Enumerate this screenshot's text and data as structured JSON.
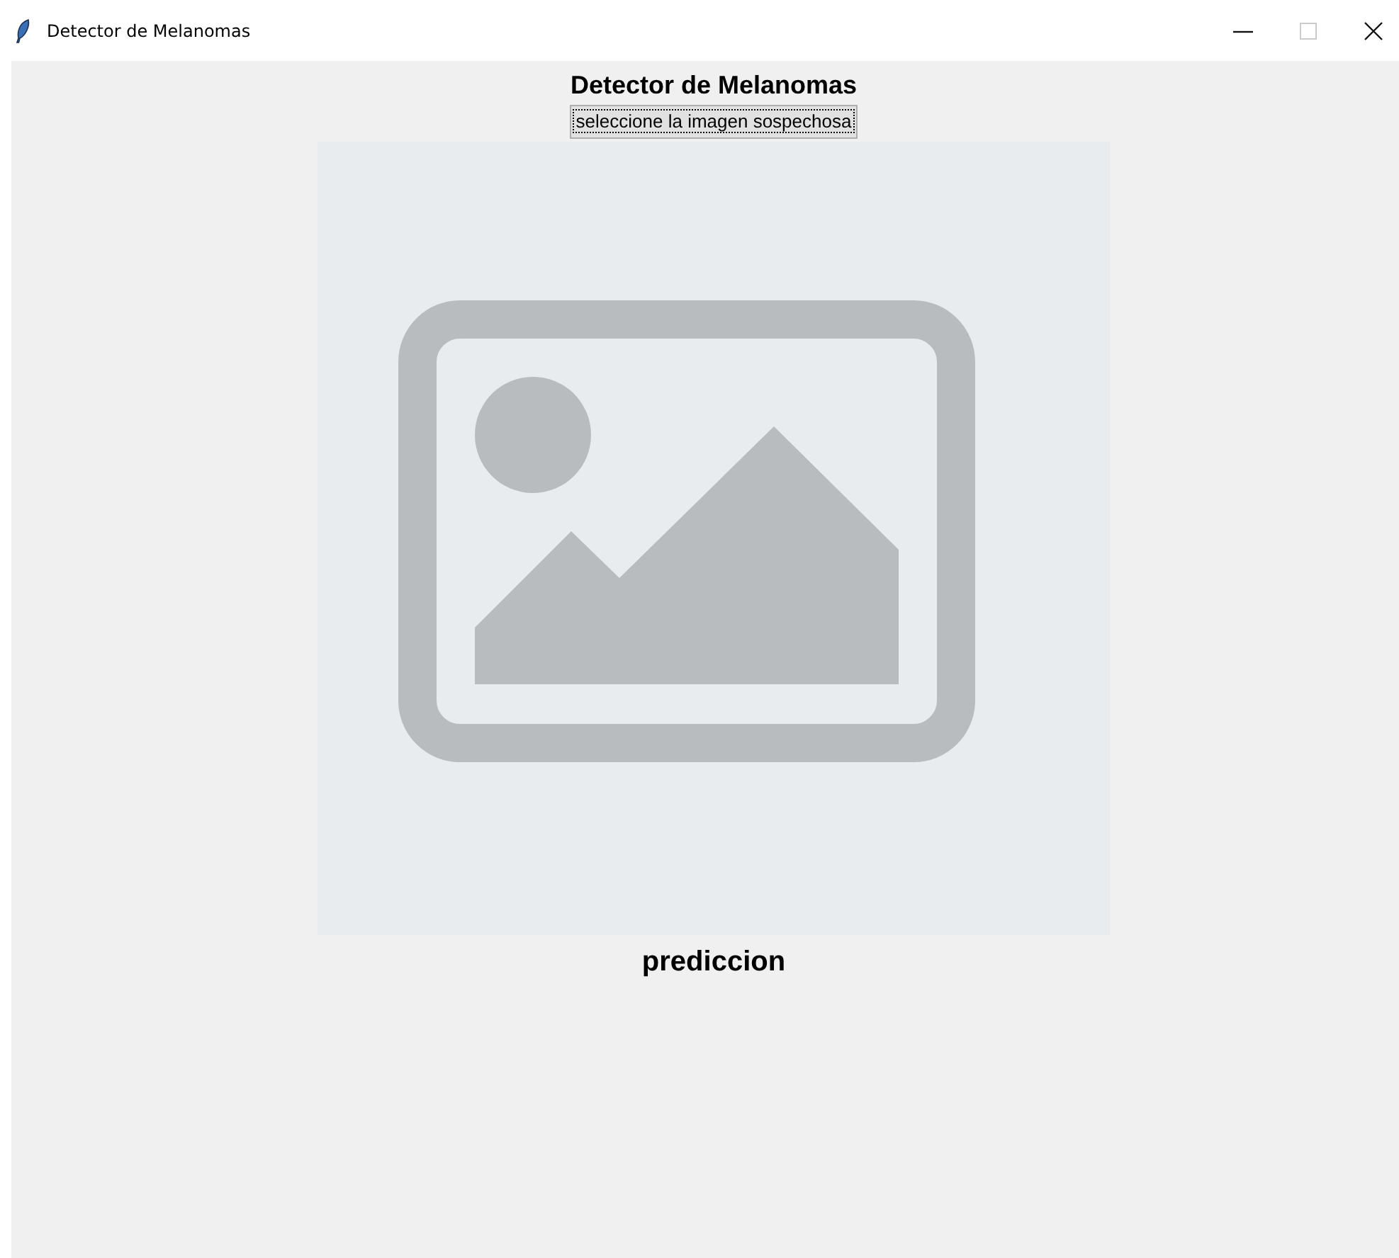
{
  "window": {
    "title": "Detector de Melanomas",
    "maximize_disabled": true
  },
  "heading": "Detector de Melanomas",
  "select_button": {
    "label": "seleccione la imagen sospechosa",
    "focused": true
  },
  "image_preview": {
    "kind": "placeholder"
  },
  "prediction_label": "prediccion"
}
